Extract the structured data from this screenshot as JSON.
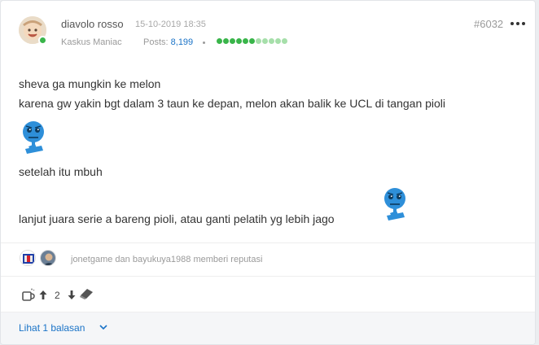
{
  "post": {
    "username": "diavolo rosso",
    "date": "15-10-2019 18:35",
    "number": "#6032",
    "rank": "Kaskus Maniac",
    "posts_label": "Posts:",
    "posts_count": "8,199",
    "reputation_bar": [
      "#39b54a",
      "#39b54a",
      "#39b54a",
      "#39b54a",
      "#39b54a",
      "#39b54a",
      "#a6dfaa",
      "#a6dfaa",
      "#a6dfaa",
      "#a6dfaa",
      "#a6dfaa"
    ]
  },
  "content": {
    "line1": "sheva ga mungkin ke melon",
    "line2": "karena gw yakin bgt dalam 3 taun ke depan, melon akan balik ke UCL di tangan pioli",
    "line3": "setelah itu mbuh",
    "line4": "lanjut juara serie a bareng pioli, atau ganti pelatih yg lebih jago",
    "emoticon_icon": "sad-blue-face-emoticon",
    "emoticon_color": "#2e8fd9"
  },
  "reputation": {
    "text": "jonetgame dan bayukuya1988 memberi reputasi"
  },
  "actions": {
    "vote_count": "2",
    "icons": [
      "coffee-icon",
      "upvote-arrow-icon",
      "downvote-arrow-icon",
      "eraser-icon"
    ]
  },
  "footer": {
    "replies_label": "Lihat 1 balasan",
    "chevron_icon": "chevron-down-icon",
    "link_color": "#1a73c7"
  }
}
